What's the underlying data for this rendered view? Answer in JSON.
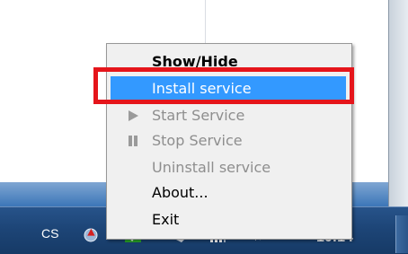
{
  "context_menu": {
    "items": [
      {
        "label": "Show/Hide",
        "state": "bold"
      },
      {
        "label": "Install service",
        "state": "highlighted"
      },
      {
        "label": "Start Service",
        "state": "disabled",
        "icon": "play-icon"
      },
      {
        "label": "Stop Service",
        "state": "disabled",
        "icon": "pause-icon"
      },
      {
        "label": "Uninstall service",
        "state": "disabled"
      },
      {
        "label": "About...",
        "state": "enabled"
      },
      {
        "label": "Exit",
        "state": "enabled"
      }
    ]
  },
  "taskbar": {
    "language": "CS",
    "clock": "10:14",
    "tray_icons": [
      "network-warning-icon",
      "check-shield-icon",
      "power-plug-icon",
      "signal-icon",
      "volume-icon"
    ]
  },
  "colors": {
    "highlight": "#3399ff",
    "annotation_box": "#e5151b",
    "taskbar": "#1d4577"
  }
}
